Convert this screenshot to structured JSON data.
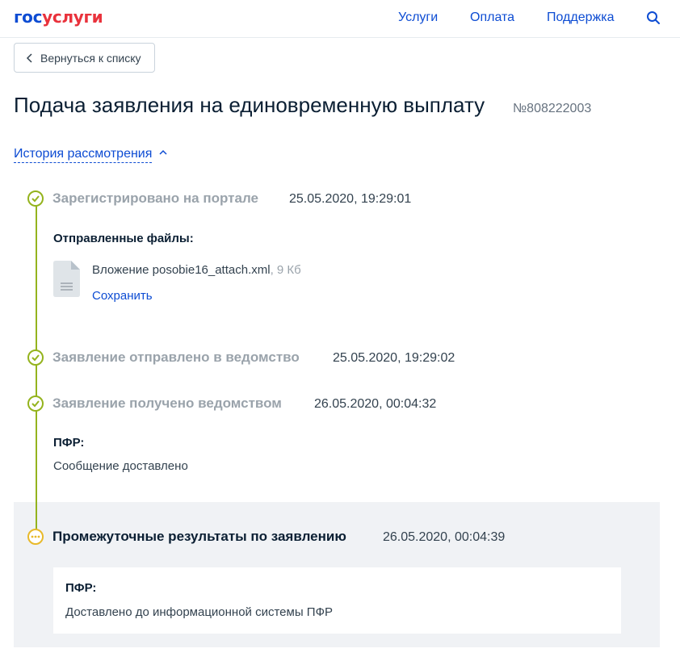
{
  "header": {
    "logo_part1": "гос",
    "logo_part2": "услуги",
    "nav": [
      "Услуги",
      "Оплата",
      "Поддержка"
    ],
    "search_icon": "search-icon"
  },
  "back_button": {
    "label": "Вернуться к списку",
    "icon": "chevron-left-icon"
  },
  "page": {
    "title": "Подача заявления на единовременную выплату",
    "number": "№808222003"
  },
  "history": {
    "toggle_label": "История рассмотрения",
    "icon": "chevron-up-icon"
  },
  "timeline": [
    {
      "status": "done",
      "title": "Зарегистрировано на портале",
      "date": "25.05.2020, 19:29:01",
      "files_heading": "Отправленные файлы:",
      "file": {
        "name": "Вложение posobie16_attach.xml",
        "size": ", 9 Кб",
        "save_label": "Сохранить",
        "icon": "document-icon"
      }
    },
    {
      "status": "done",
      "title": "Заявление отправлено в ведомство",
      "date": "25.05.2020, 19:29:02"
    },
    {
      "status": "done",
      "title": "Заявление получено ведомством",
      "date": "26.05.2020, 00:04:32",
      "org": "ПФР:",
      "message": "Сообщение доставлено"
    },
    {
      "status": "in-progress",
      "title": "Промежуточные результаты по заявлению",
      "date": "26.05.2020, 00:04:39",
      "org": "ПФР:",
      "message": "Доставлено до информационной системы ПФР"
    }
  ],
  "colors": {
    "link": "#0d4cd3",
    "done": "#94b31d",
    "in_progress": "#e8b92a",
    "brand_red": "#e9323c"
  }
}
